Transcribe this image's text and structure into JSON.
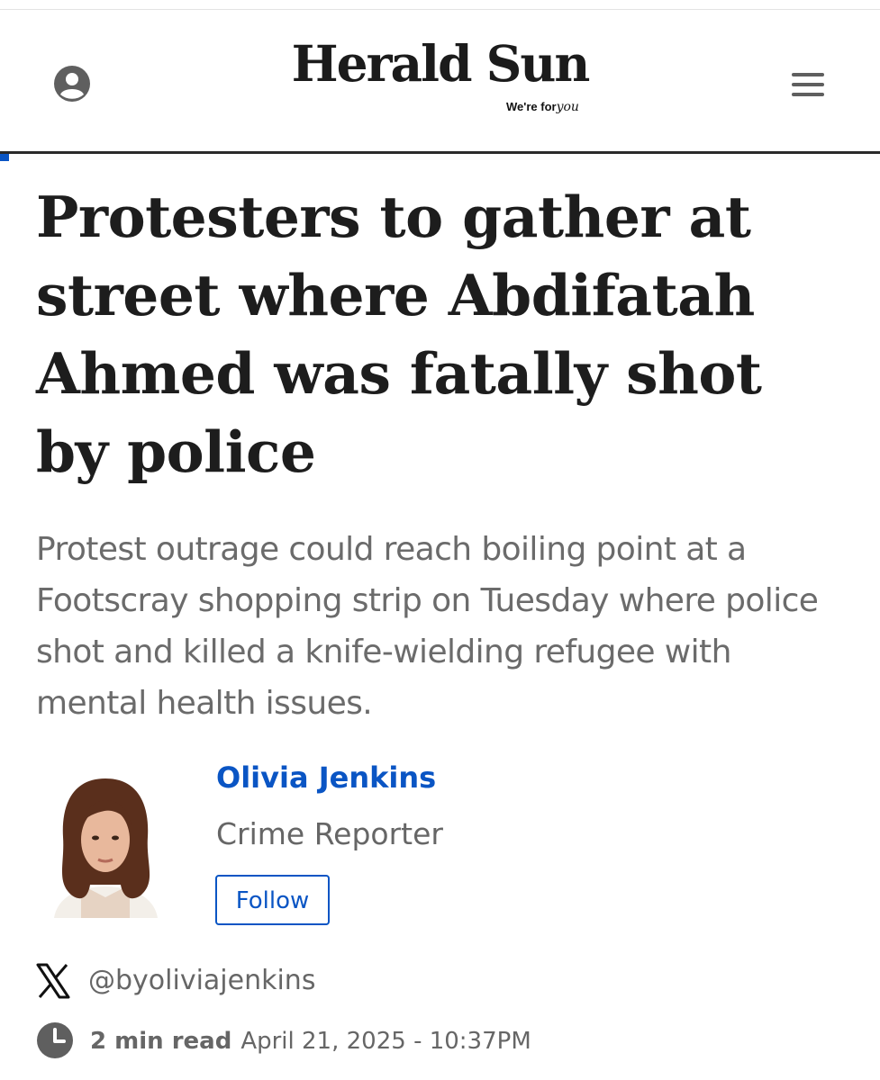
{
  "header": {
    "logo": "Herald Sun",
    "tagline_prefix": "We're for",
    "tagline_suffix": "you",
    "account_icon": "account-icon",
    "menu_icon": "menu-icon"
  },
  "article": {
    "headline": "Protesters to gather at street where Abdifatah Ahmed was fatally shot by police",
    "standfirst": "Protest outrage could reach boiling point at a Footscray shopping strip on Tuesday where police shot and killed a knife-wielding refugee with mental health issues."
  },
  "author": {
    "name": "Olivia Jenkins",
    "role": "Crime Reporter",
    "follow_label": "Follow",
    "x_handle": "@byoliviajenkins",
    "social_icon": "x-icon"
  },
  "meta": {
    "read_time": "2 min read",
    "published": "April 21, 2025 - 10:37PM",
    "clock_icon": "clock-icon"
  },
  "colors": {
    "accent": "#0a55c4",
    "headline": "#1d1d1d",
    "muted": "#6b6b6b"
  }
}
